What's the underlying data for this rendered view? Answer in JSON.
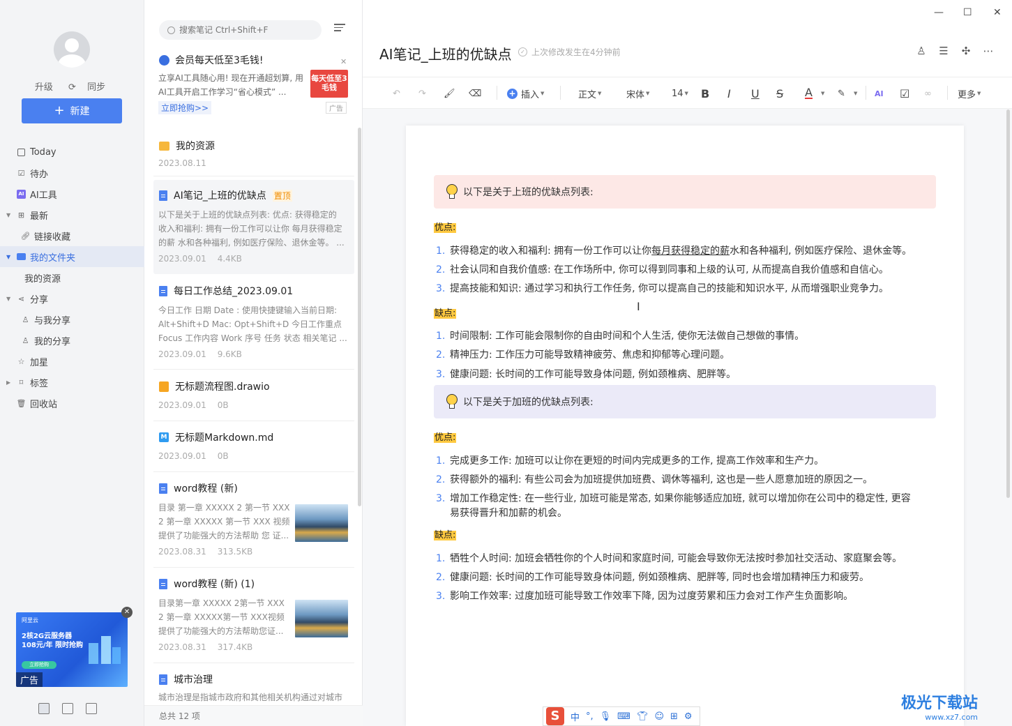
{
  "sidebar": {
    "upgrade": "升级",
    "sync": "同步",
    "new_button": "新建",
    "items": [
      {
        "label": "Today"
      },
      {
        "label": "待办"
      },
      {
        "label": "AI工具"
      },
      {
        "label": "最新"
      },
      {
        "label": "链接收藏"
      },
      {
        "label": "我的文件夹"
      },
      {
        "label": "我的资源"
      },
      {
        "label": "分享"
      },
      {
        "label": "与我分享"
      },
      {
        "label": "我的分享"
      },
      {
        "label": "加星"
      },
      {
        "label": "标签"
      },
      {
        "label": "回收站"
      }
    ],
    "ad": {
      "brand": "阿里云",
      "headline": "2核2G云服务器 108元/年 限时抢购",
      "cta": "立即抢购",
      "tag": "广告"
    }
  },
  "list": {
    "search_placeholder": "搜索笔记 Ctrl+Shift+F",
    "promo": {
      "title": "会员每天低至3毛钱!",
      "desc": "立享AI工具随心用! 现在开通超划算, 用AI工具开启工作学习“省心模式” ...",
      "image_text": "每天低至3毛钱",
      "link": "立即抢购>>",
      "ad": "广告"
    },
    "notes": [
      {
        "title": "我的资源",
        "date": "2023.08.11",
        "size": ""
      },
      {
        "title": "AI笔记_上班的优缺点",
        "pin": "置顶",
        "desc": [
          "以下是关于上班的优缺点列表:  优点:  获得稳定的",
          "收入和福利: 拥有一份工作可以让你 每月获得稳定",
          "的薪 水和各种福利, 例如医疗保险、退休金等。 ..."
        ],
        "date": "2023.09.01",
        "size": "4.4KB"
      },
      {
        "title": "每日工作总结_2023.09.01",
        "desc": [
          "今日工作 日期 Date :  使用快捷键输入当前日期:",
          "Alt+Shift+D Mac: Opt+Shift+D 今日工作重点",
          "Focus 工作内容 Work 序号 任务 状态 相关笔记 ..."
        ],
        "date": "2023.09.01",
        "size": "9.6KB"
      },
      {
        "title": "无标题流程图.drawio",
        "date": "2023.09.01",
        "size": "0B"
      },
      {
        "title": "无标题Markdown.md",
        "date": "2023.09.01",
        "size": "0B"
      },
      {
        "title": "word教程 (新)",
        "desc": [
          "目录 第一章 XXXXX 2 第一节 XXX",
          "2 第一章 XXXXX 第一节 XXX 视频",
          "提供了功能强大的方法帮助 您 证..."
        ],
        "date": "2023.08.31",
        "size": "313.5KB"
      },
      {
        "title": "word教程 (新) (1)",
        "desc": [
          "目录第一章 XXXXX 2第一节 XXX",
          "2 第一章 XXXXX第一节 XXX视频",
          "提供了功能强大的方法帮助您证..."
        ],
        "date": "2023.08.31",
        "size": "317.4KB"
      },
      {
        "title": "城市治理",
        "desc": [
          "城市治理是指城市政府和其他相关机构通过对城市"
        ],
        "date": "",
        "size": ""
      }
    ],
    "total": "总共 12 项"
  },
  "editor": {
    "title": "AI笔记_上班的优缺点",
    "saved": "上次修改发生在4分钟前",
    "toolbar": {
      "insert": "插入",
      "style": "正文",
      "font": "宋体",
      "size": "14",
      "more": "更多"
    },
    "sections": {
      "work_callout": "以下是关于上班的优缺点列表:",
      "pros_label": "优点:",
      "work_pros": [
        {
          "pre": "获得稳定的收入和福利: 拥有一份工作可以让你",
          "u": "每月获得稳定的薪",
          "post": "水和各种福利, 例如医疗保险、退休金等。"
        },
        {
          "text": "社会认同和自我价值感: 在工作场所中, 你可以得到同事和上级的认可, 从而提高自我价值感和自信心。"
        },
        {
          "text": "提高技能和知识: 通过学习和执行工作任务, 你可以提高自己的技能和知识水平, 从而增强职业竞争力。"
        }
      ],
      "cons_label": "缺点:",
      "work_cons": [
        "时间限制: 工作可能会限制你的自由时间和个人生活, 使你无法做自己想做的事情。",
        "精神压力: 工作压力可能导致精神疲劳、焦虑和抑郁等心理问题。",
        "健康问题: 长时间的工作可能导致身体问题, 例如颈椎病、肥胖等。"
      ],
      "ot_callout": "以下是关于加班的优缺点列表:",
      "ot_pros": [
        "完成更多工作: 加班可以让你在更短的时间内完成更多的工作, 提高工作效率和生产力。",
        "获得额外的福利: 有些公司会为加班提供加班费、调休等福利, 这也是一些人愿意加班的原因之一。",
        "增加工作稳定性: 在一些行业, 加班可能是常态, 如果你能够适应加班, 就可以增加你在公司中的稳定性, 更容",
        "易获得晋升和加薪的机会。"
      ],
      "ot_cons": [
        "牺牲个人时间: 加班会牺牲你的个人时间和家庭时间, 可能会导致你无法按时参加社交活动、家庭聚会等。",
        "健康问题: 长时间的工作可能导致身体问题, 例如颈椎病、肥胖等, 同时也会增加精神压力和疲劳。",
        "影响工作效率: 过度加班可能导致工作效率下降, 因为过度劳累和压力会对工作产生负面影响。"
      ]
    }
  },
  "ime": {
    "label": "中"
  },
  "watermark": {
    "main": "极光下载站",
    "sub": "www.xz7.com"
  }
}
